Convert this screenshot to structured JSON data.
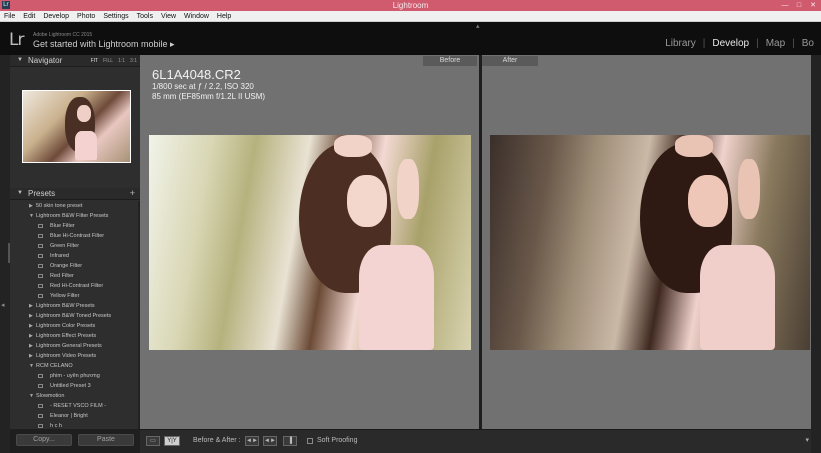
{
  "window": {
    "title": "Lightroom",
    "app_badge": "Lr"
  },
  "menu": [
    "File",
    "Edit",
    "Develop",
    "Photo",
    "Settings",
    "Tools",
    "View",
    "Window",
    "Help"
  ],
  "identity": {
    "logo": "Lr",
    "product": "Adobe Lightroom CC 2015",
    "promo": "Get started with Lightroom mobile ▸"
  },
  "modules": {
    "items": [
      "Library",
      "Develop",
      "Map",
      "Bo"
    ],
    "active": "Develop"
  },
  "navigator": {
    "title": "Navigator",
    "zoom_options": [
      "FIT",
      "FILL",
      "1:1",
      "3:1"
    ],
    "active_zoom": "FIT"
  },
  "presets": {
    "title": "Presets",
    "add_label": "+",
    "rows": [
      {
        "kind": "group",
        "expanded": false,
        "label": "50 skin tone preset"
      },
      {
        "kind": "group",
        "expanded": true,
        "label": "Lightroom B&W Filter Presets"
      },
      {
        "kind": "item",
        "label": "Blue Filter"
      },
      {
        "kind": "item",
        "label": "Blue Hi-Contrast Filter"
      },
      {
        "kind": "item",
        "label": "Green Filter"
      },
      {
        "kind": "item",
        "label": "Infrared"
      },
      {
        "kind": "item",
        "label": "Orange Filter"
      },
      {
        "kind": "item",
        "label": "Red Filter"
      },
      {
        "kind": "item",
        "label": "Red Hi-Contrast Filter"
      },
      {
        "kind": "item",
        "label": "Yellow Filter"
      },
      {
        "kind": "group",
        "expanded": false,
        "label": "Lightroom B&W Presets"
      },
      {
        "kind": "group",
        "expanded": false,
        "label": "Lightroom B&W Toned Presets"
      },
      {
        "kind": "group",
        "expanded": false,
        "label": "Lightroom Color Presets"
      },
      {
        "kind": "group",
        "expanded": false,
        "label": "Lightroom Effect Presets"
      },
      {
        "kind": "group",
        "expanded": false,
        "label": "Lightroom General Presets"
      },
      {
        "kind": "group",
        "expanded": false,
        "label": "Lightroom Video Presets"
      },
      {
        "kind": "group",
        "expanded": true,
        "label": "RCM CELANO"
      },
      {
        "kind": "item",
        "label": "phim - uyên phương"
      },
      {
        "kind": "item",
        "label": "Untitled Preset 3"
      },
      {
        "kind": "group",
        "expanded": true,
        "label": "Slowmotion"
      },
      {
        "kind": "item",
        "label": "- RESET VSCO FILM -"
      },
      {
        "kind": "item",
        "label": "Eleanor | Bright"
      },
      {
        "kind": "item",
        "label": "h c h"
      }
    ]
  },
  "left_buttons": {
    "copy": "Copy...",
    "paste": "Paste"
  },
  "compare": {
    "before_label": "Before",
    "after_label": "After"
  },
  "photo_info": {
    "filename": "6L1A4048.CR2",
    "exposure": "1/800 sec at ƒ / 2.2, ISO 320",
    "lens": "85 mm (EF85mm f/1.2L II USM)"
  },
  "toolbar": {
    "view_single": "▭",
    "view_yy": "Y|Y",
    "before_after_label": "Before & After :",
    "swap_1": "◄►",
    "swap_2": "◄►",
    "swap_3": "▐",
    "soft_proofing": "Soft Proofing",
    "menu_caret": "▾"
  },
  "colors": {
    "titlebar": "#d05a6e",
    "panel": "#2e2e2e",
    "center": "#717171"
  }
}
